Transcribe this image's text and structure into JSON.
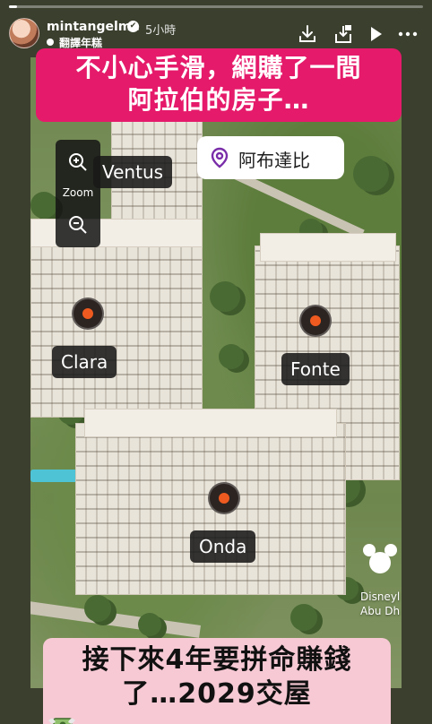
{
  "story": {
    "progress": 0.02,
    "username": "mintangelme",
    "verified_mark": "✔",
    "time_ago": "5小時",
    "translate_label": "翻譯年糕"
  },
  "header_icons": [
    "download-icon",
    "share-icon",
    "play-icon",
    "more-icon"
  ],
  "captions": {
    "top_line_1": "不小心手滑，網購了一間",
    "top_line_2": "阿拉伯的房子…",
    "bottom_line_1": "接下來4年要拼命賺錢",
    "bottom_line_2": "了…2029交屋"
  },
  "map": {
    "zoom_label": "Zoom",
    "zoom_in": "+",
    "zoom_out": "−",
    "location": "阿布達比",
    "buildings": [
      "Ventus",
      "Clara",
      "Fonte",
      "Onda"
    ],
    "partner_line_1": "Disneyl",
    "partner_line_2": "Abu Dh"
  },
  "colors": {
    "caption_top_bg": "#e61a6a",
    "caption_bottom_bg": "#f6c9d4",
    "pin_accent": "#ee5a1f",
    "location_pin": "#7a2da8"
  }
}
